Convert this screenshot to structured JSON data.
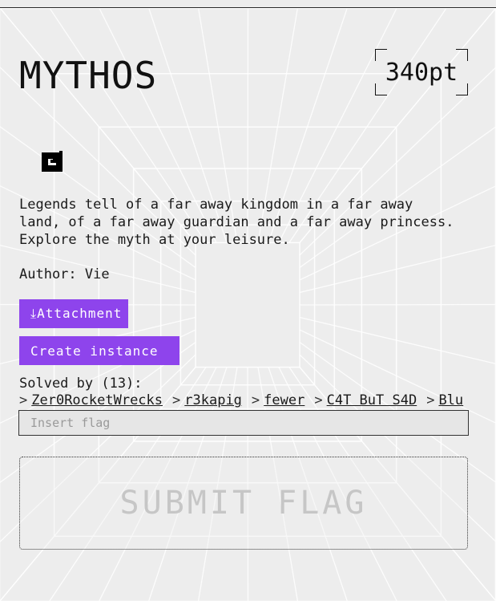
{
  "challenge": {
    "title": "MYTHOS",
    "points": "340pt",
    "icon": "spiral-icon",
    "description": "Legends tell of a far away kingdom in a far away\nland, of a far away guardian and a far away princess.\nExplore the myth at your leisure.",
    "author": "Author: Vie"
  },
  "actions": {
    "attachment_label": "⤓Attachment",
    "create_instance_label": "Create instance"
  },
  "solves": {
    "label": "Solved by (13):",
    "separator": ">",
    "solvers": [
      "Zer0RocketWrecks",
      "r3kapig",
      "fewer",
      "C4T BuT S4D",
      "Blu"
    ]
  },
  "flag": {
    "placeholder": "Insert flag",
    "value": "",
    "submit_label": "SUBMIT FLAG"
  },
  "colors": {
    "accent": "#8e44ec",
    "background": "#ededed",
    "grid_lines": "#ffffff"
  }
}
